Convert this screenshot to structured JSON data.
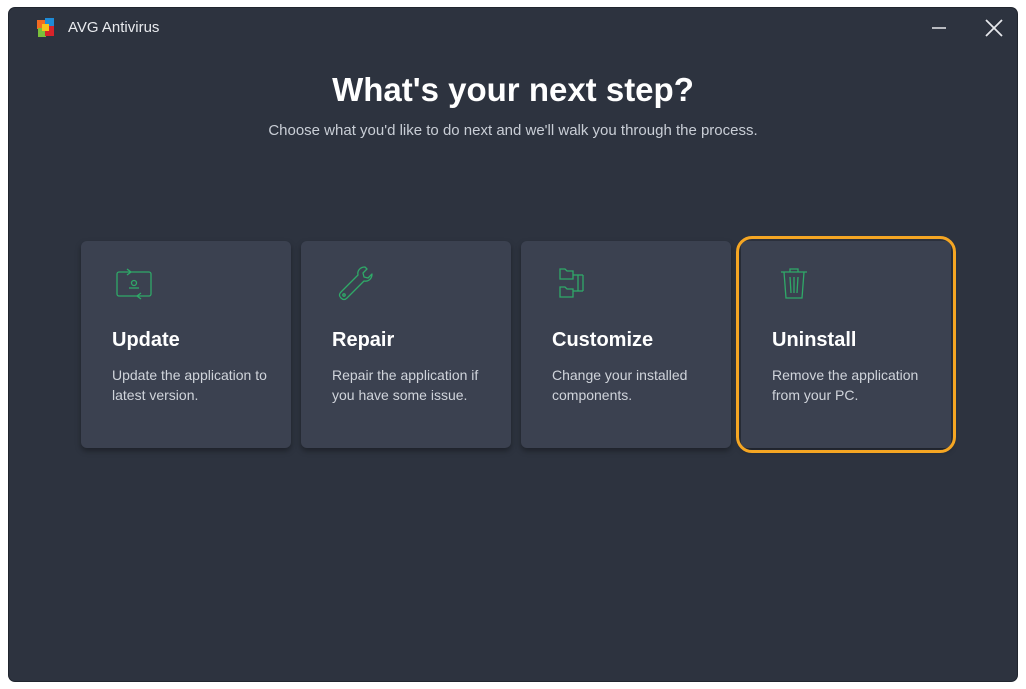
{
  "window": {
    "title": "AVG Antivirus",
    "logo_icon": "avg-logo-icon",
    "minimize_icon": "minimize-icon",
    "close_icon": "close-icon"
  },
  "main": {
    "heading": "What's your next step?",
    "subheading": "Choose what you'd like to do next and we'll walk you through the process."
  },
  "options": [
    {
      "title": "Update",
      "description": "Update the application to latest version.",
      "icon": "update-icon",
      "selected": false
    },
    {
      "title": "Repair",
      "description": "Repair the application if you have some issue.",
      "icon": "wrench-icon",
      "selected": false
    },
    {
      "title": "Customize",
      "description": "Change your installed components.",
      "icon": "components-icon",
      "selected": false
    },
    {
      "title": "Uninstall",
      "description": "Remove the application from your PC.",
      "icon": "trash-icon",
      "selected": true
    }
  ],
  "colors": {
    "background": "#2d333f",
    "card": "#3b4150",
    "icon_accent": "#2fa968",
    "highlight": "#f5a623"
  }
}
